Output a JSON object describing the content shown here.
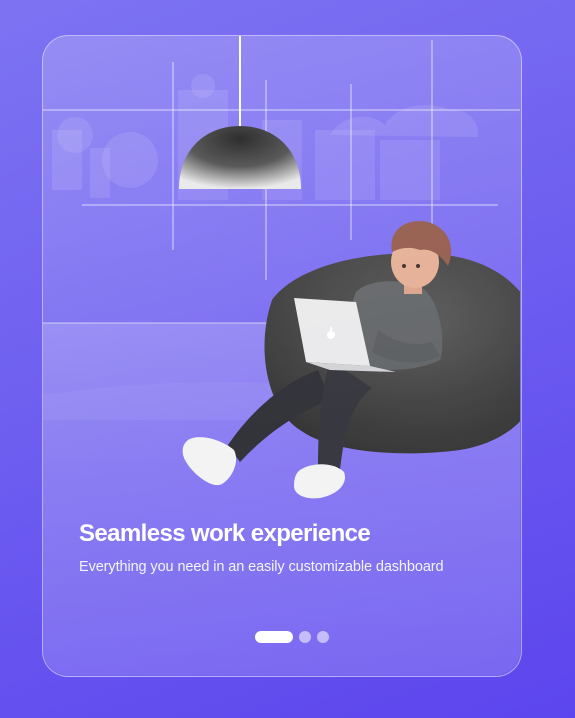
{
  "onboarding": {
    "title": "Seamless work experience",
    "subtitle": "Everything you need in an easily customizable dashboard",
    "pager": {
      "total": 3,
      "active_index": 0
    }
  },
  "colors": {
    "background": "#6d5df0",
    "card_border": "#ffffff",
    "text": "#ffffff"
  },
  "icons": [
    "apple-logo-icon"
  ]
}
